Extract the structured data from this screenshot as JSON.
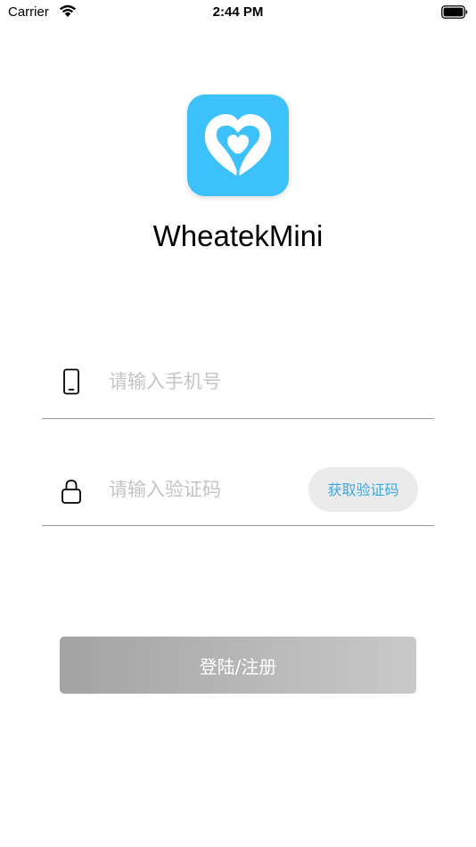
{
  "status_bar": {
    "carrier": "Carrier",
    "time": "2:44 PM",
    "wifi_icon": "wifi-icon",
    "battery_icon": "battery-icon"
  },
  "app": {
    "name": "WheatekMini",
    "icon": "heart-logo-icon",
    "icon_color": "#3cc1fb"
  },
  "form": {
    "phone": {
      "icon": "phone-icon",
      "placeholder": "请输入手机号",
      "value": ""
    },
    "code": {
      "icon": "lock-icon",
      "placeholder": "请输入验证码",
      "value": "",
      "get_code_label": "获取验证码"
    },
    "login_label": "登陆/注册"
  },
  "colors": {
    "accent": "#3da8e6",
    "button_gradient_start": "#a3a3a3",
    "button_gradient_end": "#c9c9c9"
  }
}
